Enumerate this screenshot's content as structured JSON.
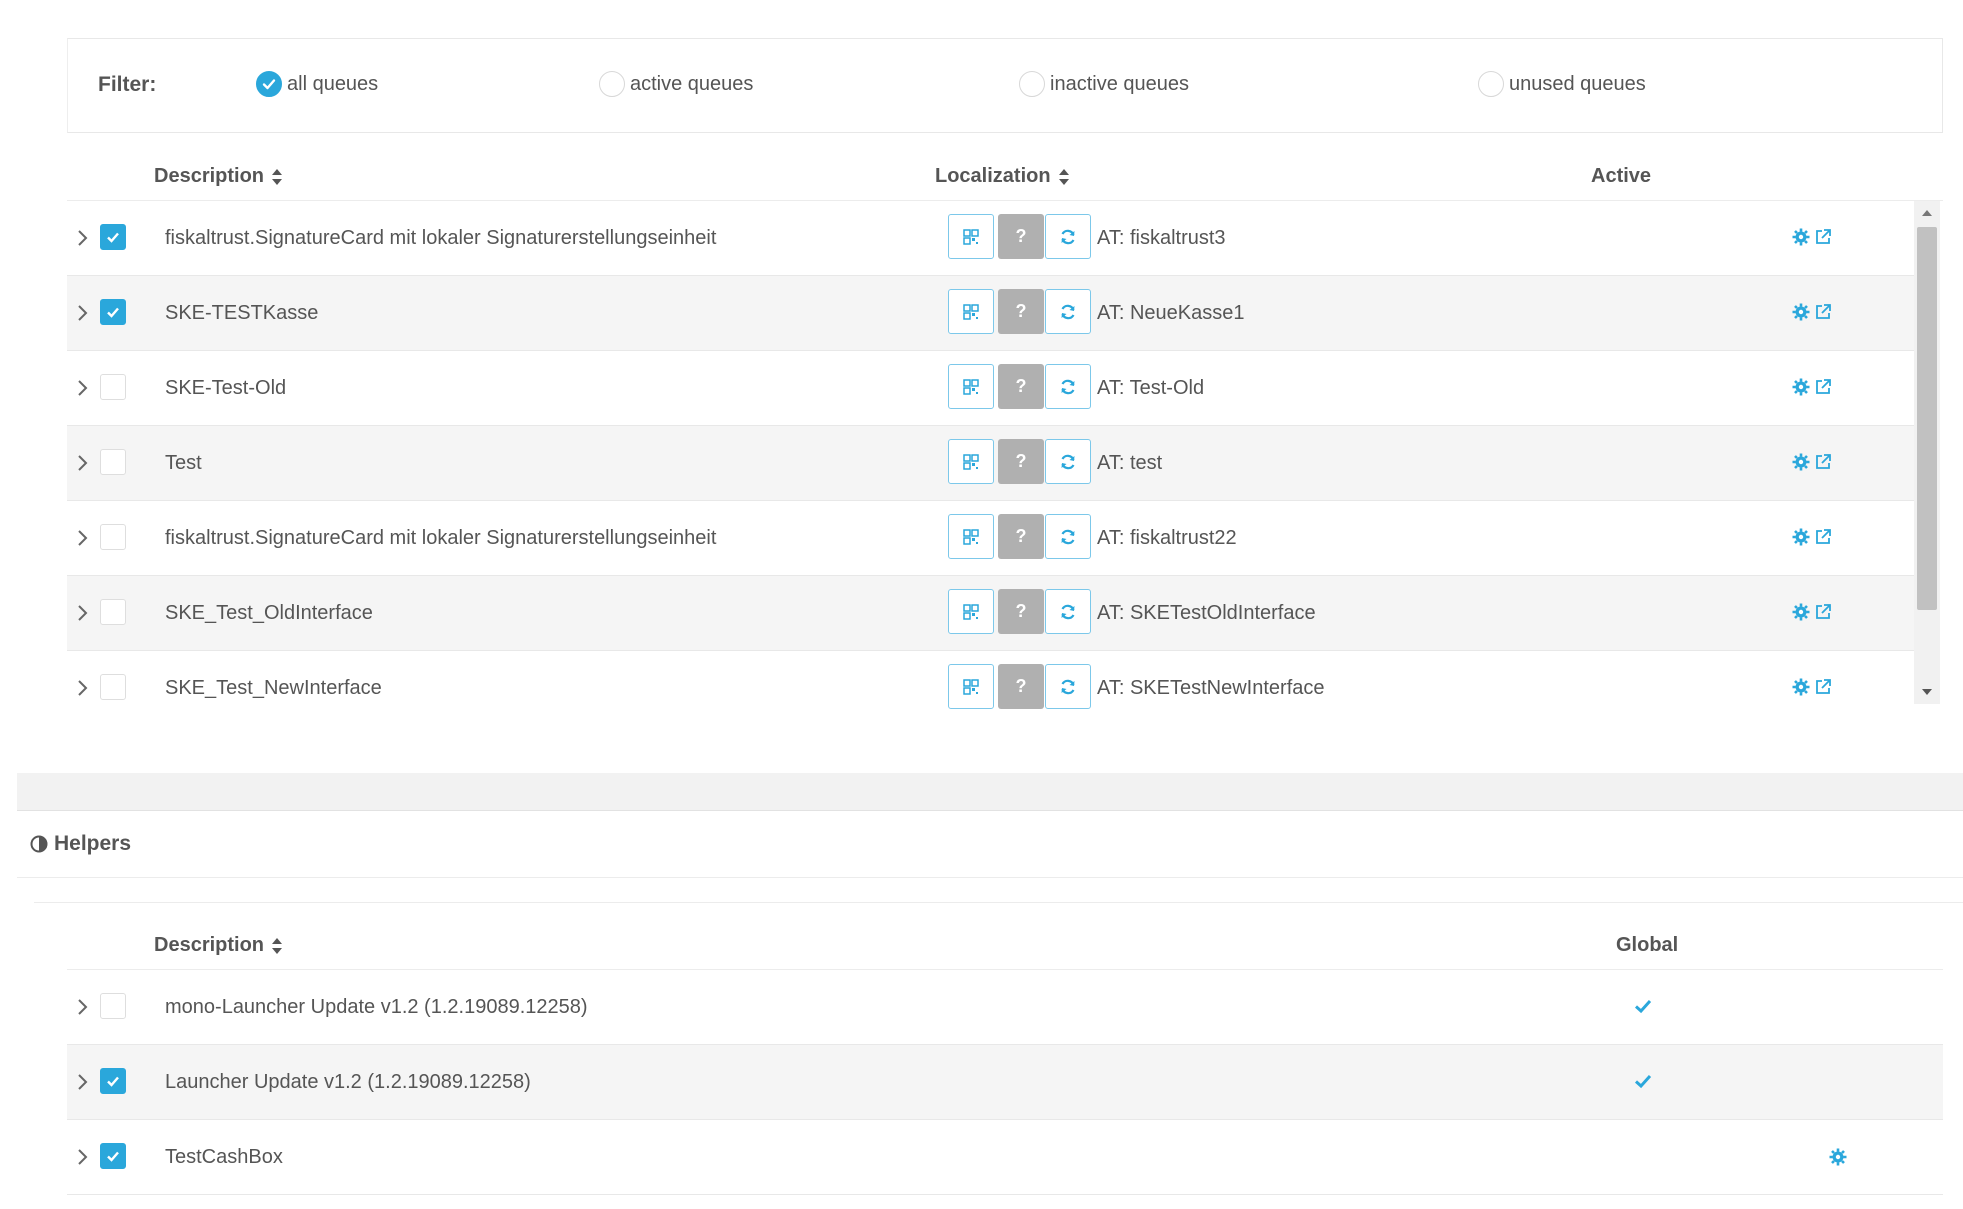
{
  "filter": {
    "label": "Filter:",
    "options": [
      {
        "label": "all queues",
        "selected": true
      },
      {
        "label": "active queues",
        "selected": false
      },
      {
        "label": "inactive queues",
        "selected": false
      },
      {
        "label": "unused queues",
        "selected": false
      }
    ]
  },
  "queues": {
    "columns": {
      "description": "Description",
      "localization": "Localization",
      "active": "Active"
    },
    "buttons": {
      "help": "?"
    },
    "rows": [
      {
        "checked": true,
        "description": "fiskaltrust.SignatureCard mit lokaler Signaturerstellungseinheit",
        "localization": "AT: fiskaltrust3"
      },
      {
        "checked": true,
        "description": "SKE-TESTKasse",
        "localization": "AT: NeueKasse1"
      },
      {
        "checked": false,
        "description": "SKE-Test-Old",
        "localization": "AT: Test-Old"
      },
      {
        "checked": false,
        "description": "Test",
        "localization": "AT: test"
      },
      {
        "checked": false,
        "description": "fiskaltrust.SignatureCard mit lokaler Signaturerstellungseinheit",
        "localization": "AT: fiskaltrust22"
      },
      {
        "checked": false,
        "description": "SKE_Test_OldInterface",
        "localization": "AT: SKETestOldInterface"
      },
      {
        "checked": false,
        "description": "SKE_Test_NewInterface",
        "localization": "AT: SKETestNewInterface"
      }
    ]
  },
  "helpers": {
    "title": "Helpers",
    "columns": {
      "description": "Description",
      "global": "Global"
    },
    "rows": [
      {
        "checked": false,
        "description": "mono-Launcher Update v1.2 (1.2.19089.12258)",
        "global": true,
        "settings": false
      },
      {
        "checked": true,
        "description": "Launcher Update v1.2 (1.2.19089.12258)",
        "global": true,
        "settings": false
      },
      {
        "checked": true,
        "description": "TestCashBox",
        "global": false,
        "settings": true
      }
    ]
  },
  "colors": {
    "accent": "#2aa7db",
    "text": "#555555",
    "row_alt": "#f5f5f5",
    "help_button": "#b0b0b0"
  }
}
